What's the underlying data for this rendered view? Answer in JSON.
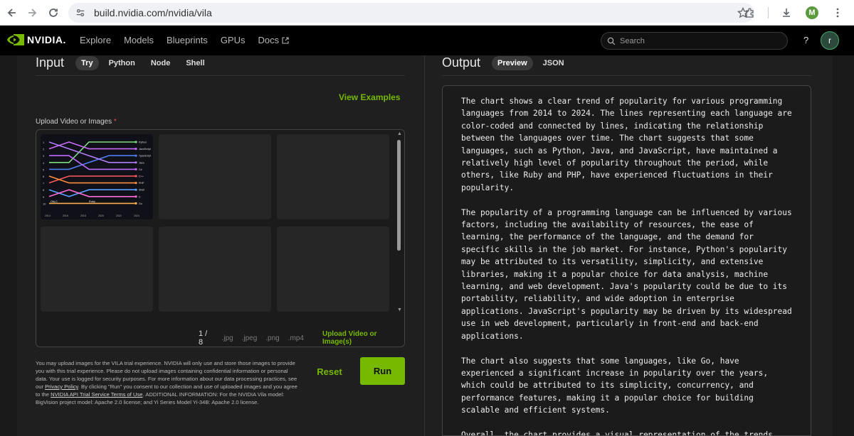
{
  "browser": {
    "url": "build.nvidia.com/nvidia/vila",
    "profile_initial": "M"
  },
  "header": {
    "logo_text": "NVIDIA.",
    "nav": [
      "Explore",
      "Models",
      "Blueprints",
      "GPUs",
      "Docs"
    ],
    "search_placeholder": "Search",
    "help": "?",
    "avatar_initial": "r"
  },
  "input": {
    "title": "Input",
    "tabs": [
      "Try",
      "Python",
      "Node",
      "Shell"
    ],
    "view_examples": "View Examples",
    "upload_label": "Upload Video or Images",
    "required_mark": "*",
    "page_count": "1 / 8",
    "extensions": [
      ".jpg",
      ".jpeg",
      ".png",
      ".mp4"
    ],
    "upload_link": "Upload Video or Image(s)",
    "disclaimer": {
      "part1": "You may upload images for the VILA trial experience. NVIDIA will only use and store those images to provide you with this trial experience. Please do not upload images containing confidential information or personal data. Your use is logged for security purposes. For more information about our data processing practices, see our ",
      "link1": "Privacy Policy",
      "part2": ". By clicking \"Run\" you consent to our collection and use of uploaded images and you agree to the ",
      "link2": "NVIDIA API Trial Service Terms of Use",
      "part3": ". ADDITIONAL INFORMATION: For the NVIDIA Vila model: BigVision project model: Apache 2.0 license; and Yi Series Model Yi-34B: Apache 2.0 license."
    },
    "reset_label": "Reset",
    "run_label": "Run"
  },
  "output": {
    "title": "Output",
    "tabs": [
      "Preview",
      "JSON"
    ],
    "paragraphs": [
      "The chart shows a clear trend of popularity for various programming languages from 2014 to 2024. The lines representing each language are color-coded and connected by lines, indicating the relationship between the languages over time. The chart suggests that some languages, such as Python, Java, and JavaScript, have maintained a relatively high level of popularity throughout the period, while others, like Ruby and PHP, have experienced fluctuations in their popularity.",
      "The popularity of a programming language can be influenced by various factors, including the availability of resources, the ease of learning, the performance of the language, and the demand for specific skills in the job market. For instance, Python's popularity may be attributed to its versatility, simplicity, and extensive libraries, making it a popular choice for data analysis, machine learning, and web development. Java's popularity could be due to its portability, reliability, and wide adoption in enterprise applications. JavaScript's popularity may be driven by its widespread use in web development, particularly in front-end and back-end applications.",
      "The chart also suggests that some languages, like Go, have experienced a significant increase in popularity over the years, which could be attributed to its simplicity, concurrency, and performance features, making it a popular choice for building scalable and efficient systems.",
      "Overall, the chart provides a visual representation of the trends"
    ]
  },
  "thumbnail": {
    "ranks": [
      "1",
      "2",
      "3",
      "4",
      "5",
      "6",
      "7",
      "8",
      "9",
      "10"
    ],
    "labels": [
      "Python",
      "JavaScript",
      "TypeScript",
      "Java",
      "C#",
      "C++",
      "PHP",
      "Shell",
      "C",
      "Go"
    ],
    "inline_labels": [
      "Obj-C",
      "Ruby"
    ],
    "years": [
      "2014",
      "2016",
      "2018",
      "2020",
      "2022",
      "2024"
    ],
    "colors": [
      "#7ee081",
      "#c86bfa",
      "#4f7df0",
      "#b07cf5",
      "#bd6bff",
      "#ff5a5a",
      "#ff8c3a",
      "#5aa0ff",
      "#ff6ad5",
      "#ffb04a"
    ]
  }
}
